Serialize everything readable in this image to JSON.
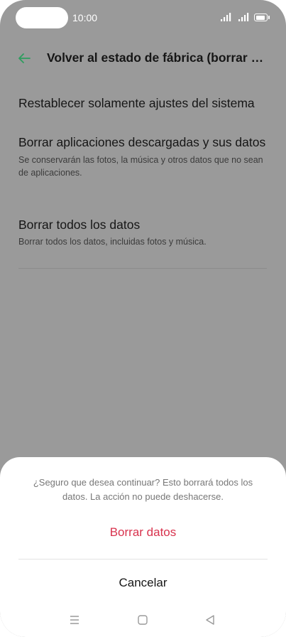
{
  "status_bar": {
    "time": "10:00"
  },
  "header": {
    "title": "Volver al estado de fábrica (borrar todo)"
  },
  "options": [
    {
      "label": "Restablecer solamente ajustes del sistema",
      "description": ""
    },
    {
      "label": "Borrar aplicaciones descargadas y sus datos",
      "description": "Se conservarán las fotos, la música y otros datos que no sean de aplicaciones."
    },
    {
      "label": "Borrar todos los datos",
      "description": "Borrar todos los datos, incluidas fotos y música."
    }
  ],
  "dialog": {
    "message": "¿Seguro que desea continuar? Esto borrará todos los datos. La acción no puede deshacerse.",
    "confirm_label": "Borrar datos",
    "cancel_label": "Cancelar"
  },
  "icons": {
    "back": "back-arrow-icon",
    "signal": "cellular-signal-icon",
    "battery": "battery-icon",
    "nav_menu": "menu-icon",
    "nav_home": "home-icon",
    "nav_back": "back-triangle-icon"
  },
  "colors": {
    "accent": "#2e9d5f",
    "destructive": "#d8324d",
    "overlay": "#9a9a9a"
  }
}
